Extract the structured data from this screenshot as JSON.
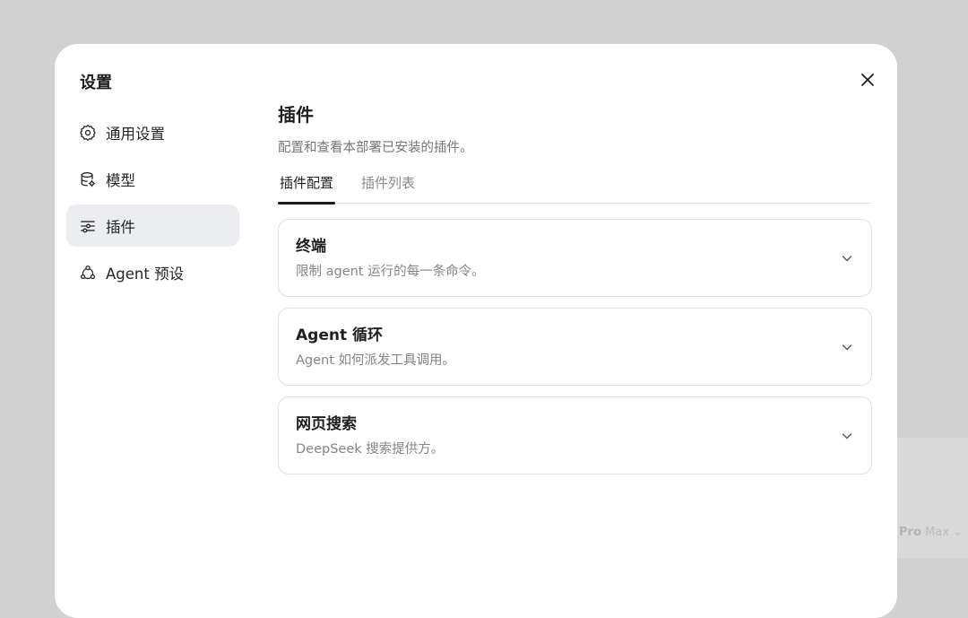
{
  "background": {
    "model_name": "Pro",
    "model_suffix": "Max"
  },
  "modal": {
    "title": "设置",
    "close_icon": "close-icon"
  },
  "nav": {
    "items": [
      {
        "label": "通用设置",
        "icon": "gear-icon"
      },
      {
        "label": "模型",
        "icon": "database-gear-icon"
      },
      {
        "label": "插件",
        "icon": "sliders-icon",
        "active": true
      },
      {
        "label": "Agent 预设",
        "icon": "agent-network-icon"
      }
    ]
  },
  "content": {
    "title": "插件",
    "description": "配置和查看本部署已安装的插件。",
    "tabs": [
      {
        "label": "插件配置",
        "active": true
      },
      {
        "label": "插件列表",
        "active": false
      }
    ],
    "cards": [
      {
        "title": "终端",
        "description": "限制 agent 运行的每一条命令。"
      },
      {
        "title": "Agent 循环",
        "description": "Agent 如何派发工具调用。"
      },
      {
        "title": "网页搜索",
        "description": "DeepSeek 搜索提供方。"
      }
    ]
  },
  "colors": {
    "active_nav_bg": "#ebedf1",
    "active_tab_underline": "#1a1a1a",
    "backdrop": "#d1d1d1"
  }
}
